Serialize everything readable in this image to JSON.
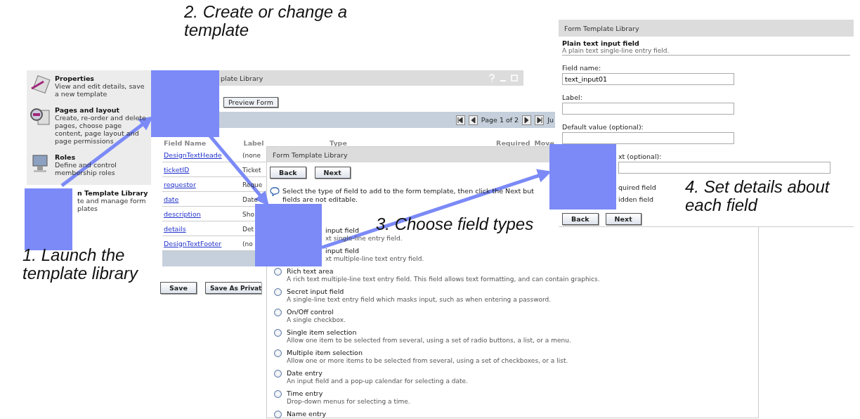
{
  "step_captions": [
    "2. Create or change a template",
    "1. Launch the template library",
    "3. Choose field types",
    "4. Set details about each field"
  ],
  "menu_panel": {
    "items": [
      {
        "kind": "full",
        "title": "Properties",
        "description": "View and edit details, save a new template"
      },
      {
        "kind": "full",
        "title": "Pages and layout",
        "description": "Create, re-order and delete pages, choose page content, page layout and page permissions"
      },
      {
        "kind": "full",
        "title": "Roles",
        "description": "Define and control membership roles"
      },
      {
        "kind": "covered",
        "title": "n Template Library",
        "description": "te and manage form plates"
      }
    ]
  },
  "library_window": {
    "title": "plate Library",
    "preview_button": "Preview Form",
    "pager_text": "Page 1 of 2",
    "pager_cut_label": "Ju",
    "columns": [
      "Field Name",
      "Label",
      "Type",
      "Required",
      "Move"
    ],
    "rows": [
      {
        "field_name": "DesignTextHeade",
        "label": "(none"
      },
      {
        "field_name": "ticketID",
        "label": "Ticket"
      },
      {
        "field_name": "requestor",
        "label": "Reque"
      },
      {
        "field_name": "date",
        "label": "Date"
      },
      {
        "field_name": "description",
        "label": "Sho"
      },
      {
        "field_name": "details",
        "label": "Det"
      },
      {
        "field_name": "DesignTextFooter",
        "label": "(no"
      }
    ],
    "buttons": [
      "Save",
      "Save As Privat"
    ]
  },
  "field_type_window": {
    "title": "Form Template Library",
    "buttons": [
      "Back",
      "Next"
    ],
    "instruction_lines": [
      "Select the type of field to add to the form template, then click the Next but",
      "fields are not editable."
    ],
    "field_types": [
      {
        "kind": "covered",
        "title": "input field",
        "description": "xt single-line entry field."
      },
      {
        "kind": "covered",
        "title": "input field",
        "description": "xt multiple-line text entry field."
      },
      {
        "kind": "option",
        "selected": false,
        "title": "Rich text area",
        "description": "A rich text multiple-line text entry field. This field allows text formatting, and can contain graphics."
      },
      {
        "kind": "option",
        "selected": false,
        "title": "Secret input field",
        "description": "A single-line text entry field which masks input, such as when entering a password."
      },
      {
        "kind": "option",
        "selected": false,
        "title": "On/Off control",
        "description": "A single checkbox."
      },
      {
        "kind": "option",
        "selected": false,
        "title": "Single item selection",
        "description": "Allow one item to be selected from several, using a set of radio buttons, a list, or a menu."
      },
      {
        "kind": "option",
        "selected": false,
        "title": "Multiple item selection",
        "description": "Allow one or more items to be selected from several, using a set of checkboxes, or a list."
      },
      {
        "kind": "option",
        "selected": false,
        "title": "Date entry",
        "description": "An input field and a pop-up calendar for selecting a date."
      },
      {
        "kind": "option",
        "selected": false,
        "title": "Time entry",
        "description": "Drop-down menus for selecting a time."
      },
      {
        "kind": "option",
        "selected": false,
        "title": "Name entry"
      }
    ]
  },
  "details_window": {
    "title": "Form Template Library",
    "field_type": "Plain text input field",
    "field_type_description": "A plain text single-line entry field.",
    "fields": [
      {
        "kind": "full",
        "label": "Field name:",
        "value": "text_input01"
      },
      {
        "kind": "full",
        "label": "Label:"
      },
      {
        "kind": "full",
        "label": "Default value (optional):"
      },
      {
        "kind": "covered",
        "label": "xt (optional):"
      }
    ],
    "options": [
      "quired field",
      "idden field"
    ],
    "buttons": [
      "Back",
      "Next"
    ]
  }
}
